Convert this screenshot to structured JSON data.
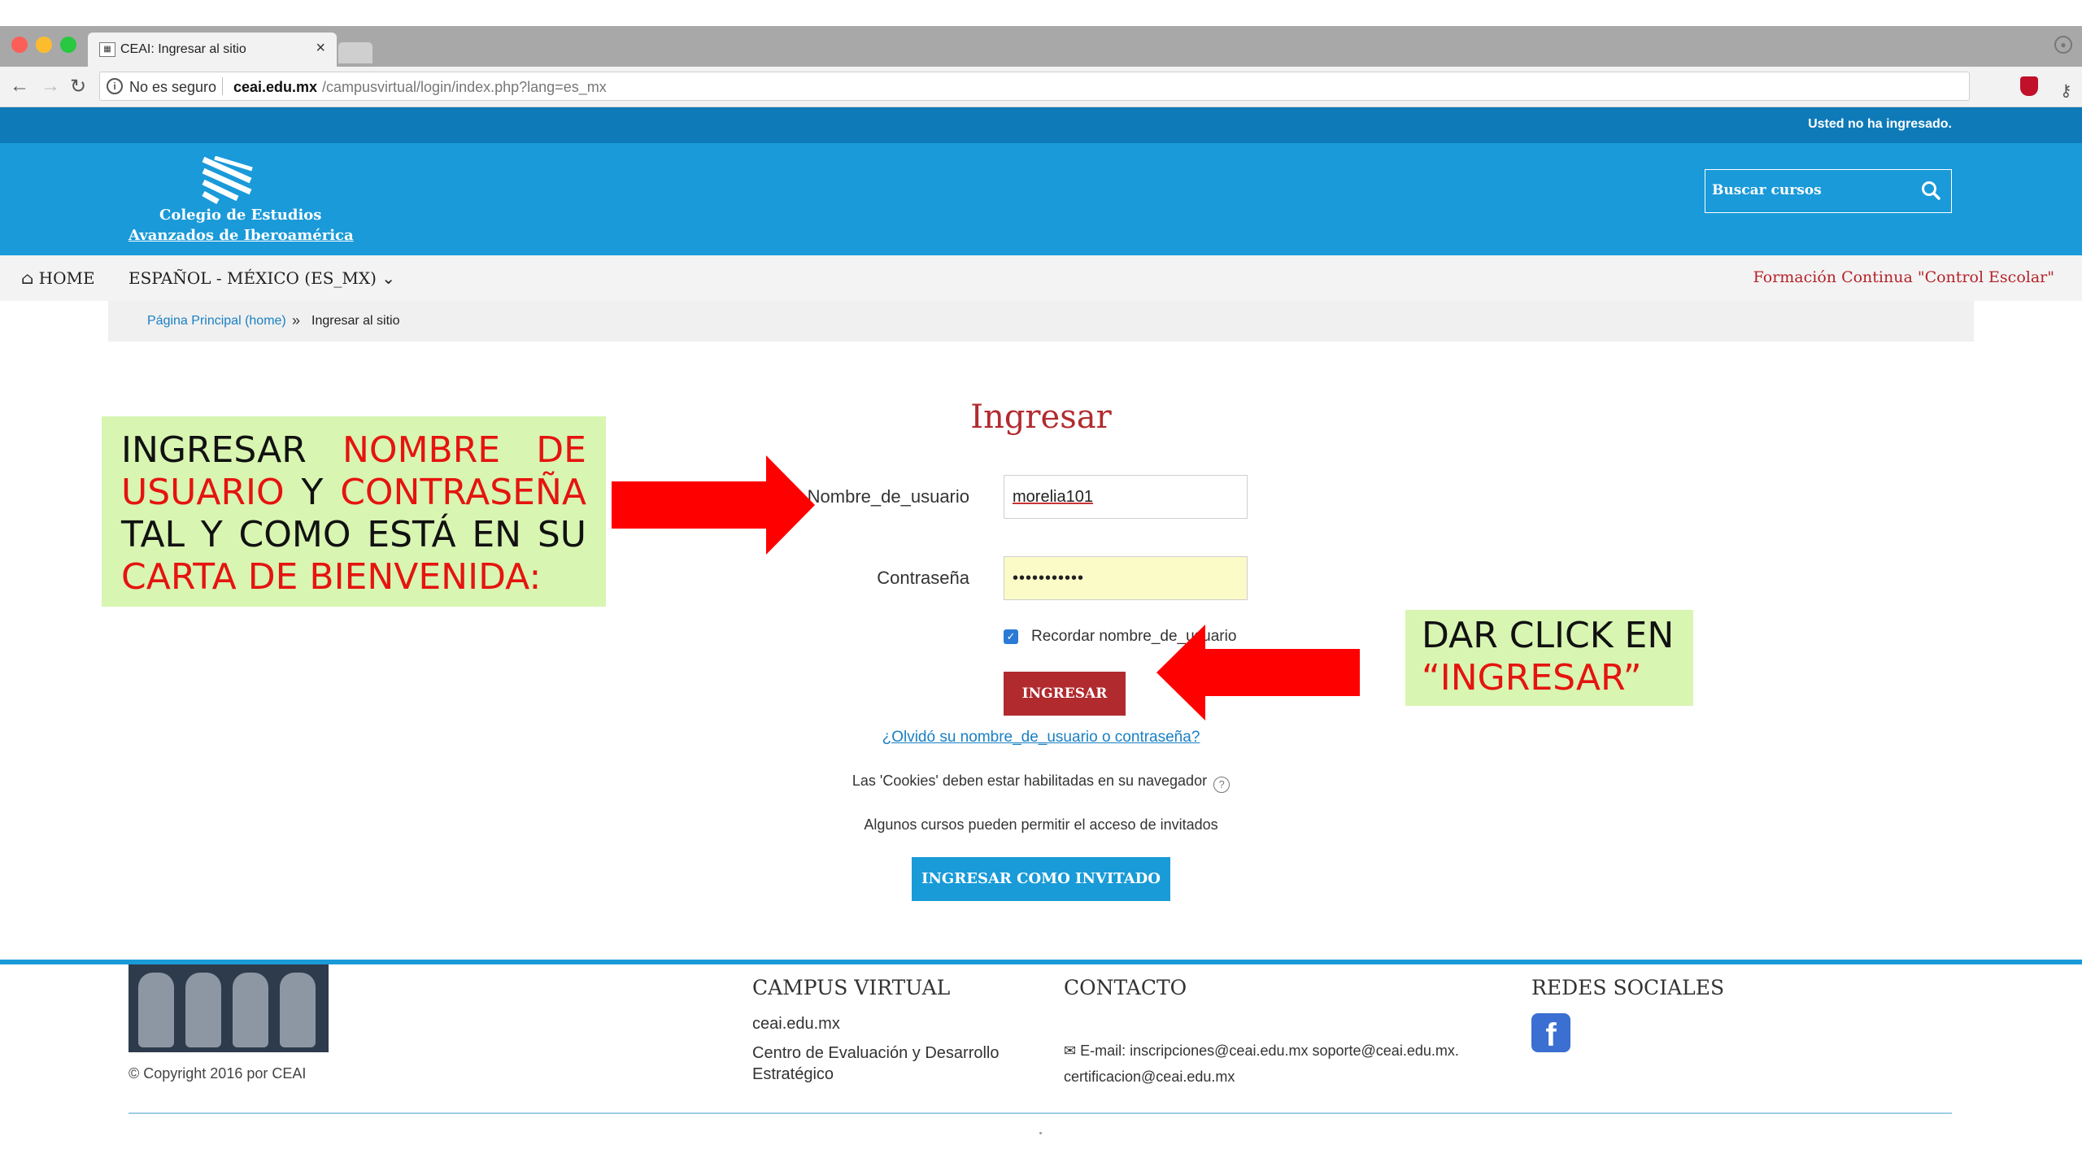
{
  "browser": {
    "tab_title": "CEAI: Ingresar al sitio",
    "tab_close": "×",
    "url_status": "No es seguro",
    "url_host": "ceai.edu.mx",
    "url_path": "/campusvirtual/login/index.php?lang=es_mx"
  },
  "site": {
    "not_logged": "Usted no ha ingresado.",
    "logo_line1": "Colegio de Estudios",
    "logo_line2": "Avanzados de Iberoamérica",
    "search_placeholder": "Buscar cursos",
    "nav": {
      "home": "HOME",
      "language": "ESPAÑOL - MÉXICO (ES_MX)",
      "right_link": "Formación Continua \"Control Escolar\""
    },
    "breadcrumb": {
      "home": "Página Principal (home)",
      "separator": "»",
      "current": "Ingresar al sitio"
    }
  },
  "login": {
    "title": "Ingresar",
    "username_label": "Nombre_de_usuario",
    "username_value": "morelia101",
    "password_label": "Contraseña",
    "password_value": "•••••••••••",
    "remember_label": "Recordar nombre_de_usuario",
    "remember_checked": true,
    "submit_label": "INGRESAR",
    "forgot_link": "¿Olvidó su nombre_de_usuario o contraseña?",
    "cookies_note": "Las 'Cookies' deben estar habilitadas en su navegador",
    "guests_note": "Algunos cursos pueden permitir el acceso de invitados",
    "guest_button": "INGRESAR COMO INVITADO"
  },
  "annotations": {
    "note1": {
      "w1": "INGRESAR",
      "w2": "NOMBRE DE USUARIO",
      "w3": "Y",
      "w4": "CONTRASEÑA",
      "w5": "TAL Y COMO ESTÁ EN SU",
      "w6": "CARTA DE BIENVENIDA:"
    },
    "note2": {
      "line1": "DAR CLICK EN",
      "line2": "“INGRESAR”"
    }
  },
  "footer": {
    "copyright": "© Copyright 2016 por CEAI",
    "campus_heading": "CAMPUS VIRTUAL",
    "campus_site": "ceai.edu.mx",
    "campus_desc": "Centro de Evaluación y Desarrollo Estratégico",
    "contact_heading": "CONTACTO",
    "contact_email": "E-mail: inscripciones@ceai.edu.mx soporte@ceai.edu.mx. certificacion@ceai.edu.mx",
    "social_heading": "REDES SOCIALES",
    "facebook_glyph": "f"
  },
  "colors": {
    "topbar": "#0e7ab8",
    "header": "#1a9ad9",
    "brand_red": "#b02a2e",
    "annotation_bg": "#d8f5b2",
    "annotation_red": "#e5140f"
  }
}
